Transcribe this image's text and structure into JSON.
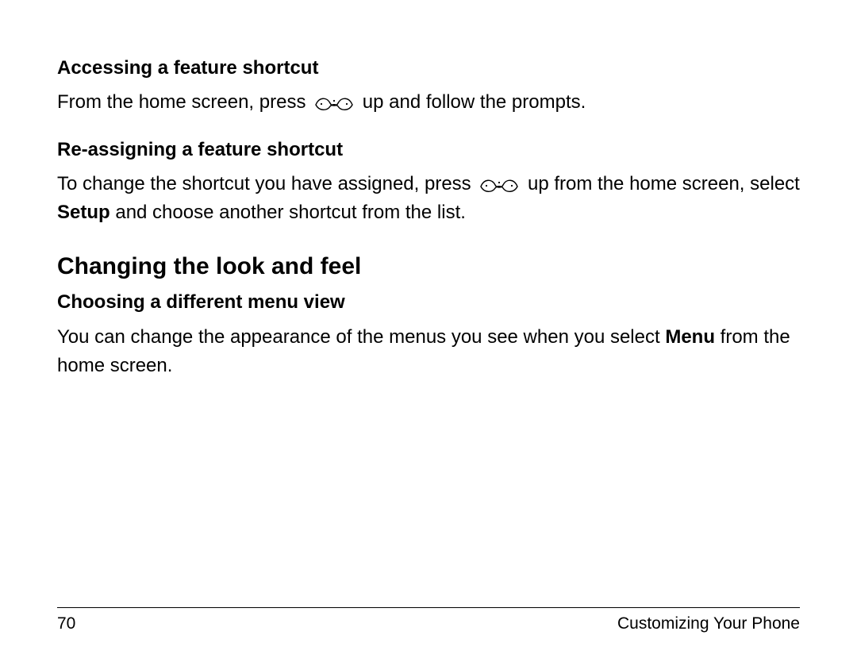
{
  "sections": {
    "s1": {
      "heading": "Accessing a feature shortcut",
      "p1a": "From the home screen, press ",
      "p1b": " up and follow the prompts."
    },
    "s2": {
      "heading": "Re-assigning a feature shortcut",
      "p1a": "To change the shortcut you have assigned, press ",
      "p1b": " up from the home screen, select ",
      "p1c_bold": "Setup",
      "p1d": " and choose another shortcut from the list."
    },
    "s3": {
      "heading": "Changing the look and feel"
    },
    "s4": {
      "heading": "Choosing a different menu view",
      "p1a": "You can change the appearance of the menus you see when you select ",
      "p1b_bold": "Menu",
      "p1c": " from the home screen."
    }
  },
  "footer": {
    "page_number": "70",
    "section_title": "Customizing Your Phone"
  }
}
